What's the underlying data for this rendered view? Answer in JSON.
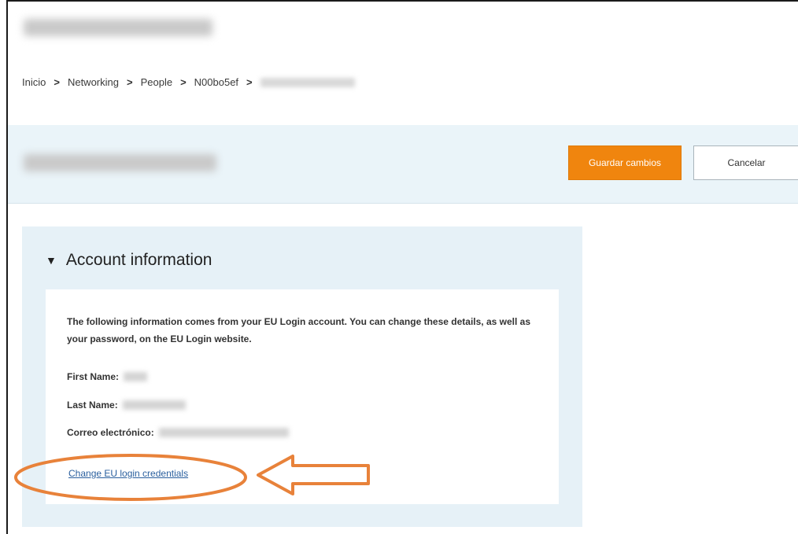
{
  "breadcrumb": {
    "items": [
      "Inicio",
      "Networking",
      "People",
      "N00bo5ef"
    ],
    "separator": ">"
  },
  "header": {
    "save_label": "Guardar cambios",
    "cancel_label": "Cancelar"
  },
  "account": {
    "title": "Account information",
    "intro": "The following information comes from your EU Login account. You can change these details, as well as your password, on the EU Login website.",
    "first_name_label": "First Name:",
    "last_name_label": "Last Name:",
    "email_label": "Correo electrónico:",
    "change_link": "Change EU login credentials"
  },
  "colors": {
    "accent_orange": "#f0850e",
    "panel_blue": "#e6f1f7",
    "link_blue": "#2a5f9e",
    "annotation_orange": "#e8823a"
  },
  "icons": {
    "toggle": "caret-down-icon",
    "breadcrumb_sep": "chevron-right-icon"
  }
}
